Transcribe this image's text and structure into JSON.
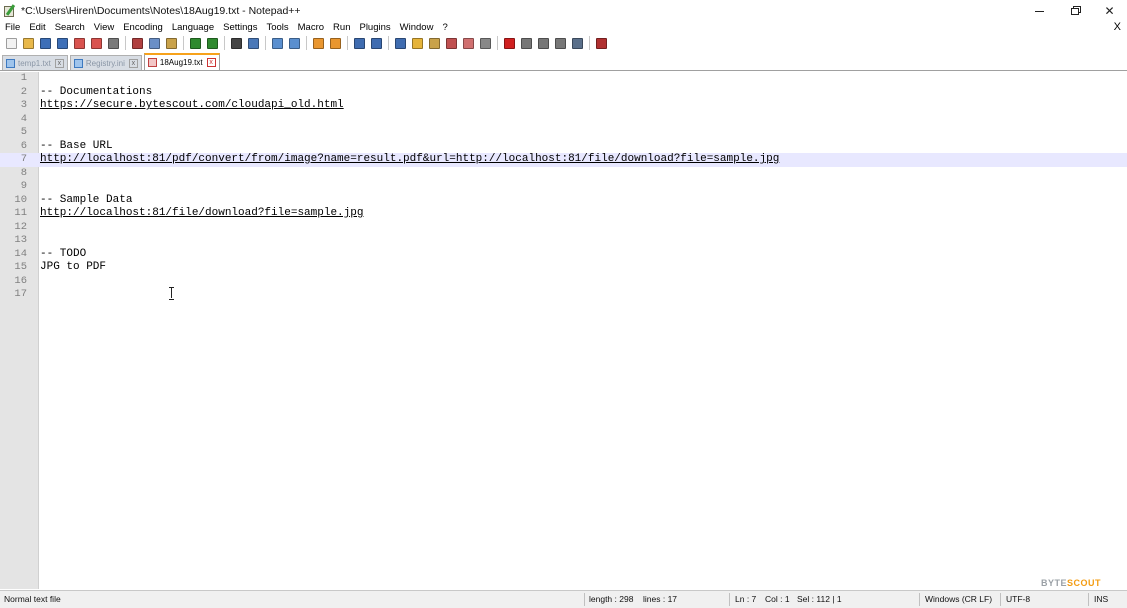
{
  "window": {
    "title": "*C:\\Users\\Hiren\\Documents\\Notes\\18Aug19.txt - Notepad++",
    "minimize_glyph": "",
    "maximize_glyph": "",
    "close_glyph": "✕"
  },
  "menu": {
    "items": [
      "File",
      "Edit",
      "Search",
      "View",
      "Encoding",
      "Language",
      "Settings",
      "Tools",
      "Macro",
      "Run",
      "Plugins",
      "Window",
      "?"
    ],
    "close_label": "X"
  },
  "toolbar": {
    "buttons": [
      {
        "icon": "new-file-icon",
        "color": "#f2f2f2"
      },
      {
        "icon": "open-file-icon",
        "color": "#e8b84a"
      },
      {
        "icon": "save-icon",
        "color": "#3d6fb8"
      },
      {
        "icon": "save-all-icon",
        "color": "#3d6fb8"
      },
      {
        "icon": "close-file-icon",
        "color": "#d9534f"
      },
      {
        "icon": "close-all-icon",
        "color": "#d9534f"
      },
      {
        "icon": "print-icon",
        "color": "#7a7a7a"
      },
      {
        "sep": true
      },
      {
        "icon": "cut-icon",
        "color": "#b04040"
      },
      {
        "icon": "copy-icon",
        "color": "#6a8fc7"
      },
      {
        "icon": "paste-icon",
        "color": "#c9a24a"
      },
      {
        "sep": true
      },
      {
        "icon": "undo-icon",
        "color": "#2f8a2f"
      },
      {
        "icon": "redo-icon",
        "color": "#2f8a2f"
      },
      {
        "sep": true
      },
      {
        "icon": "find-icon",
        "color": "#444444"
      },
      {
        "icon": "replace-icon",
        "color": "#4a78b8"
      },
      {
        "sep": true
      },
      {
        "icon": "zoom-in-icon",
        "color": "#5a8fcf"
      },
      {
        "icon": "zoom-out-icon",
        "color": "#5a8fcf"
      },
      {
        "sep": true
      },
      {
        "icon": "sync-vertical-icon",
        "color": "#e9962f"
      },
      {
        "icon": "sync-horizontal-icon",
        "color": "#e9962f"
      },
      {
        "sep": true
      },
      {
        "icon": "word-wrap-icon",
        "color": "#3f6cb0"
      },
      {
        "icon": "show-all-chars-icon",
        "color": "#3f6cb0"
      },
      {
        "sep": true
      },
      {
        "icon": "indent-guide-icon",
        "color": "#3f6cb0"
      },
      {
        "icon": "user-language-icon",
        "color": "#e6b43a"
      },
      {
        "icon": "doc-map-icon",
        "color": "#c9a24a"
      },
      {
        "icon": "function-list-icon",
        "color": "#c05050"
      },
      {
        "icon": "folder-workspace-icon",
        "color": "#d07070"
      },
      {
        "icon": "monitoring-icon",
        "color": "#888888"
      },
      {
        "sep": true
      },
      {
        "icon": "record-macro-icon",
        "color": "#d02020"
      },
      {
        "icon": "stop-record-icon",
        "color": "#777777"
      },
      {
        "icon": "play-macro-icon",
        "color": "#777777"
      },
      {
        "icon": "play-multiple-icon",
        "color": "#777777"
      },
      {
        "icon": "save-macro-icon",
        "color": "#5a6f8a"
      },
      {
        "sep": true
      },
      {
        "icon": "spell-check-icon",
        "color": "#b03030"
      }
    ]
  },
  "tabs": [
    {
      "label": "temp1.txt",
      "active": false,
      "close": "x"
    },
    {
      "label": "Registry.ini",
      "active": false,
      "close": "x"
    },
    {
      "label": "18Aug19.txt",
      "active": true,
      "close": "x"
    }
  ],
  "editor": {
    "current_line": 7,
    "lines": [
      {
        "n": "1",
        "text": ""
      },
      {
        "n": "2",
        "text": "-- Documentations"
      },
      {
        "n": "3",
        "text": "https://secure.bytescout.com/cloudapi_old.html",
        "link": true
      },
      {
        "n": "4",
        "text": ""
      },
      {
        "n": "5",
        "text": ""
      },
      {
        "n": "6",
        "text": "-- Base URL"
      },
      {
        "n": "7",
        "text": "http://localhost:81/pdf/convert/from/image?name=result.pdf&url=http://localhost:81/file/download?file=sample.jpg",
        "link": true
      },
      {
        "n": "8",
        "text": ""
      },
      {
        "n": "9",
        "text": ""
      },
      {
        "n": "10",
        "text": "-- Sample Data"
      },
      {
        "n": "11",
        "text": "http://localhost:81/file/download?file=sample.jpg",
        "link": true
      },
      {
        "n": "12",
        "text": ""
      },
      {
        "n": "13",
        "text": ""
      },
      {
        "n": "14",
        "text": "-- TODO"
      },
      {
        "n": "15",
        "text": "JPG to PDF"
      },
      {
        "n": "16",
        "text": ""
      },
      {
        "n": "17",
        "text": ""
      }
    ]
  },
  "watermark": {
    "part1": "BYTE",
    "part2": "SCOUT"
  },
  "status": {
    "file_type": "Normal text file",
    "length": "length : 298",
    "lines": "lines : 17",
    "ln": "Ln : 7",
    "col": "Col : 1",
    "sel": "Sel : 112 | 1",
    "eol": "Windows (CR LF)",
    "encoding": "UTF-8",
    "mode": "INS"
  }
}
